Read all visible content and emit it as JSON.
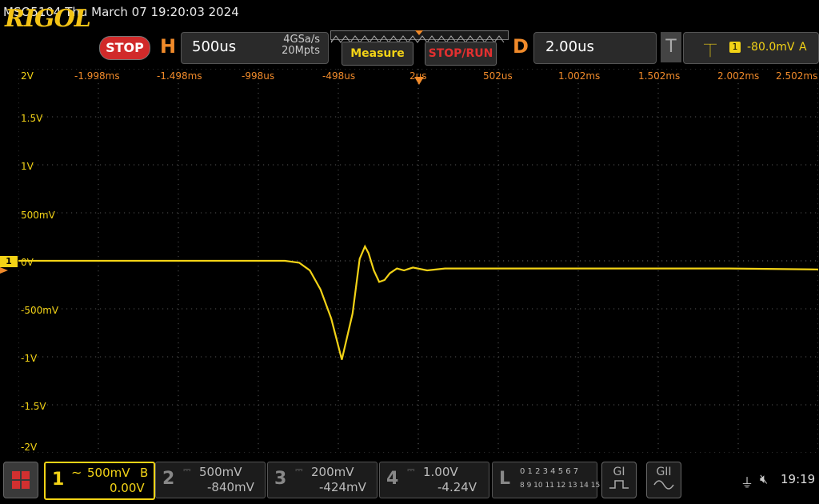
{
  "titlebar": {
    "text": "MSO5104  Thu March 07 19:20:03 2024"
  },
  "brand": {
    "logo": "RIGOL",
    "status": "STOP"
  },
  "horizontal": {
    "letter": "H",
    "timebase": "500us",
    "sample_rate": "4GSa/s",
    "memory_depth": "20Mpts"
  },
  "buttons": {
    "measure": "Measure",
    "stop_run": "STOP/RUN"
  },
  "delay": {
    "letter": "D",
    "value": "2.00us"
  },
  "trigger": {
    "letter": "T",
    "edge_icon": "rising-edge-icon",
    "source": "1",
    "level": "-80.0mV",
    "mode": "A"
  },
  "time_labels": [
    "-1.998ms",
    "-1.498ms",
    "-998us",
    "-498us",
    "2us",
    "502us",
    "1.002ms",
    "1.502ms",
    "2.002ms",
    "2.502ms"
  ],
  "volt_labels": [
    "2V",
    "1.5V",
    "1V",
    "500mV",
    "0V",
    "-500mV",
    "-1V",
    "-1.5V",
    "-2V"
  ],
  "channel_marker": "1",
  "channels": [
    {
      "num": "1",
      "coupling_icon": "ac-coupling-icon",
      "scale": "500mV",
      "bw": "B",
      "offset": "0.00V"
    },
    {
      "num": "2",
      "coupling_icon": "dc-coupling-icon",
      "scale": "500mV",
      "offset": "-840mV"
    },
    {
      "num": "3",
      "coupling_icon": "dc-coupling-icon",
      "scale": "200mV",
      "offset": "-424mV"
    },
    {
      "num": "4",
      "coupling_icon": "dc-coupling-icon",
      "scale": "1.00V",
      "offset": "-4.24V"
    }
  ],
  "logic": {
    "letter": "L",
    "row1": "0 1 2 3  4 5 6 7",
    "row2": "8 9 10 11 12 13 14 15"
  },
  "generators": [
    {
      "label": "GI"
    },
    {
      "label": "GII"
    }
  ],
  "status": {
    "time": "19:19",
    "usb_icon": "usb-icon",
    "sound_icon": "mute-icon"
  },
  "colors": {
    "ch1": "#f3d316",
    "accent": "#f08a2a",
    "stop": "#d12a2a",
    "grid": "#3a3a3a"
  },
  "chart_data": {
    "type": "line",
    "xlabel": "",
    "ylabel": "",
    "xlim": [
      -2.0,
      2.5
    ],
    "ylim": [
      -2.0,
      2.0
    ],
    "grid": true,
    "series": [
      {
        "x": [
          -2.0,
          -1.0,
          -0.5,
          -0.42,
          -0.36,
          -0.3,
          -0.24,
          -0.18,
          -0.12,
          -0.08,
          -0.05,
          -0.03,
          0.0,
          0.03,
          0.06,
          0.09,
          0.13,
          0.17,
          0.22,
          0.3,
          0.4,
          0.6,
          1.0,
          1.5,
          2.0,
          2.5
        ],
        "y": [
          0.0,
          0.0,
          0.0,
          -0.02,
          -0.1,
          -0.3,
          -0.6,
          -1.03,
          -0.55,
          0.02,
          0.15,
          0.08,
          -0.1,
          -0.22,
          -0.2,
          -0.13,
          -0.08,
          -0.1,
          -0.07,
          -0.1,
          -0.08,
          -0.08,
          -0.08,
          -0.08,
          -0.08,
          -0.09
        ]
      }
    ]
  }
}
